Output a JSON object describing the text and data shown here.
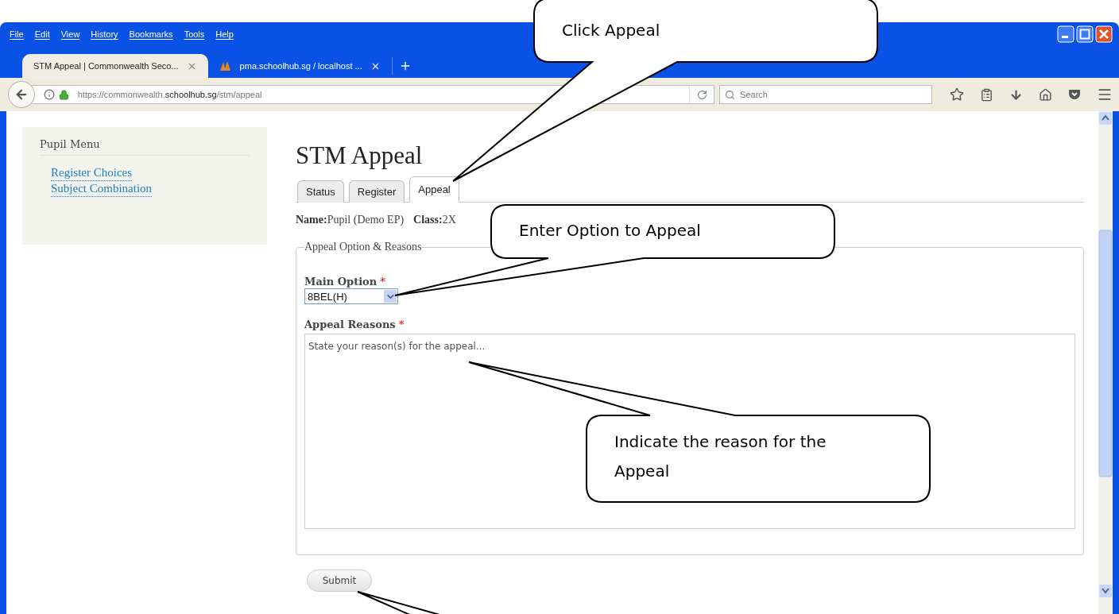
{
  "browser": {
    "menu": [
      "File",
      "Edit",
      "View",
      "History",
      "Bookmarks",
      "Tools",
      "Help"
    ],
    "tabs": [
      {
        "title": "STM Appeal | Commonwealth Seco...",
        "selected": true
      },
      {
        "title": "pma.schoolhub.sg / localhost ...",
        "selected": false
      }
    ],
    "url": {
      "prefix": "https://commonwealth.",
      "domain": "schoolhub.sg",
      "path": "/stm/appeal"
    },
    "search": {
      "placeholder": "Search"
    }
  },
  "sidebar": {
    "title": "Pupil Menu",
    "links": [
      "Register Choices",
      "Subject Combination"
    ]
  },
  "page": {
    "title": "STM Appeal",
    "tabs": [
      {
        "label": "Status",
        "selected": false
      },
      {
        "label": "Register",
        "selected": false
      },
      {
        "label": "Appeal",
        "selected": true
      }
    ],
    "info": [
      {
        "label": "Name:",
        "value": "Pupil (Demo EP)"
      },
      {
        "label": "Class:",
        "value": "2X"
      }
    ],
    "fieldset": {
      "legend": "Appeal Option & Reasons",
      "main_option": {
        "label": "Main Option",
        "required_mark": "*",
        "value": "8BEL(H)"
      },
      "reasons": {
        "label": "Appeal Reasons",
        "required_mark": "*",
        "placeholder": "State your reason(s) for the appeal..."
      }
    },
    "submit": "Submit"
  },
  "callouts": [
    {
      "lines": [
        "Click Appeal"
      ]
    },
    {
      "lines": [
        "Enter Option to Appeal"
      ]
    },
    {
      "lines": [
        "Indicate the reason for the",
        "Appeal"
      ]
    }
  ]
}
